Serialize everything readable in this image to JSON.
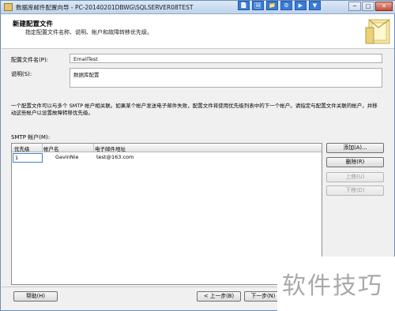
{
  "window": {
    "title": "数据库邮件配置向导 - PC-20140201DBWG\\SQLSERVER08TEST",
    "taskbar_icons": [
      "📄",
      "🖼",
      "📁",
      "⚙",
      "▶",
      "▼"
    ],
    "controls": {
      "minimize": "─",
      "maximize": "□",
      "close": "✕"
    }
  },
  "header": {
    "title": "新建配置文件",
    "subtitle": "指定配置文件名称、说明、帐户和故障转移优先级。"
  },
  "form": {
    "profile_name_label": "配置文件名(P):",
    "profile_name_value": "EmailTest",
    "description_label": "说明(S):",
    "description_value": "数据库配置",
    "note": "一个配置文件可以与多个 SMTP 帐户相关联。如果某个帐户发送电子邮件失败，配置文件将使用优先级列表中的下一个帐户。请指定与配置文件关联的帐户，并移动这些帐户以设置故障转移优先级。",
    "smtp_label": "SMTP 帐户(M):"
  },
  "accounts_table": {
    "columns": [
      "优先级",
      "帐户名",
      "电子邮件地址"
    ],
    "rows": [
      {
        "priority": "1",
        "account": "GavinNie",
        "email": "test@163.com"
      }
    ]
  },
  "side_buttons": {
    "add": "添加(A)...",
    "remove": "删除(R)",
    "move_up": "上移(U)",
    "move_down": "下移(D)"
  },
  "footer": {
    "help": "帮助(H)",
    "back": "< 上一步(B)",
    "next": "下一步(N)"
  },
  "watermark": "软件技巧"
}
